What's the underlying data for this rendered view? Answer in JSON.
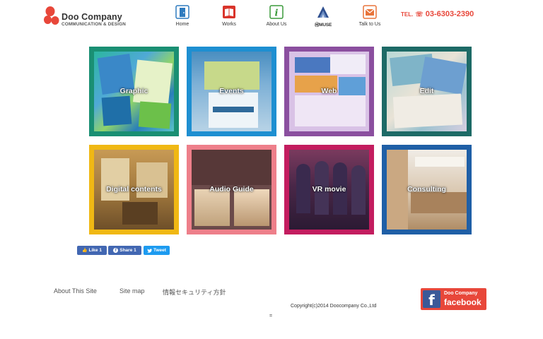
{
  "header": {
    "logo_name": "Doo Company",
    "logo_sub": "COMMUNICATION & DESIGN",
    "nav": [
      {
        "label": "Home",
        "icon": "door-icon",
        "color": "#2e7bbf"
      },
      {
        "label": "Works",
        "icon": "book-icon",
        "color": "#d9342b"
      },
      {
        "label": "About Us",
        "icon": "info-icon",
        "color": "#3a9a3a"
      },
      {
        "label": "ⓂMUSE",
        "icon": "muse-icon",
        "color": "#2f4f8f"
      },
      {
        "label": "Talk to Us",
        "icon": "mail-icon",
        "color": "#e8743a"
      }
    ],
    "tel_prefix": "TEL.",
    "tel_number": "03-6303-2390"
  },
  "tiles": [
    {
      "label": "Graphic",
      "border": "#1a8f73"
    },
    {
      "label": "Events",
      "border": "#1e8fd1"
    },
    {
      "label": "Web",
      "border": "#8b4f9f"
    },
    {
      "label": "Edit",
      "border": "#1d6a66"
    },
    {
      "label": "Digital contents",
      "border": "#f0b814"
    },
    {
      "label": "Audio Guide",
      "border": "#ee7f8a"
    },
    {
      "label": "VR movie",
      "border": "#c31d5f"
    },
    {
      "label": "Consulting",
      "border": "#1f5fa6"
    }
  ],
  "social": {
    "like": "Like 1",
    "share": "Share 1",
    "tweet": "Tweet"
  },
  "footer": {
    "links": [
      "About This Site",
      "Site map",
      "情報セキュリティ方針"
    ],
    "copyright": "Copyright(c)2014 Doocompany Co.,Ltd",
    "fb_top": "Doo Company",
    "fb_bottom": "facebook",
    "tiny": "="
  }
}
